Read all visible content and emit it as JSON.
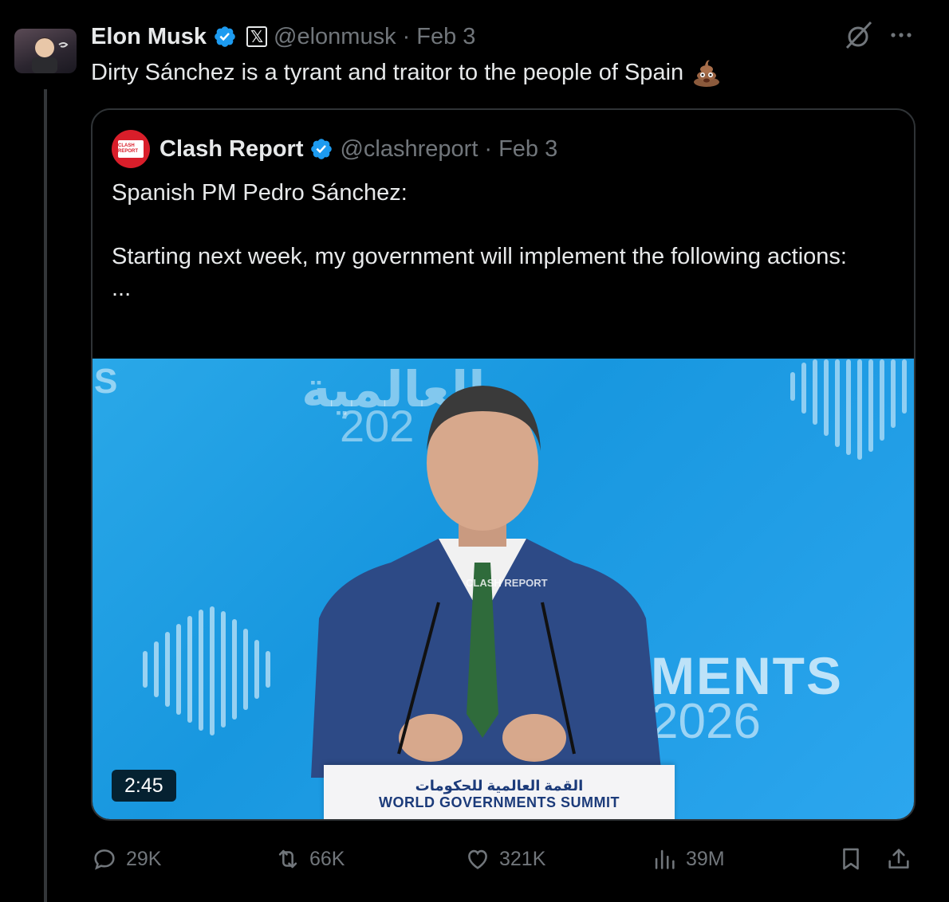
{
  "tweet": {
    "author_name": "Elon Musk",
    "handle": "@elonmusk",
    "separator": "·",
    "date": "Feb 3",
    "affiliate_badge": "𝕏",
    "text": "Dirty Sánchez is a tyrant and traitor to the people of Spain",
    "emoji": "pile-of-poo-icon"
  },
  "quote": {
    "author_name": "Clash Report",
    "handle": "@clashreport",
    "separator": "·",
    "date": "Feb 3",
    "avatar_text": "CLASH REPORT",
    "body": "Spanish PM Pedro Sánchez:\n\nStarting next week, my government will implement the following actions:\n...",
    "video": {
      "duration": "2:45",
      "watermark": "CLASH REPORT",
      "bg_arabic": "العالمية",
      "bg_year": "202",
      "bg_ments": "MENTS",
      "bg_2026": "2026",
      "bg_s": "S",
      "podium_arabic": "القمة العالمية للحكومات",
      "podium_english": "WORLD GOVERNMENTS SUMMIT"
    }
  },
  "actions": {
    "replies": "29K",
    "reposts": "66K",
    "likes": "321K",
    "views": "39M"
  },
  "colors": {
    "background": "#000000",
    "text": "#e7e9ea",
    "secondary": "#71767b",
    "verified": "#1d9bf0",
    "border": "#2f3336"
  }
}
